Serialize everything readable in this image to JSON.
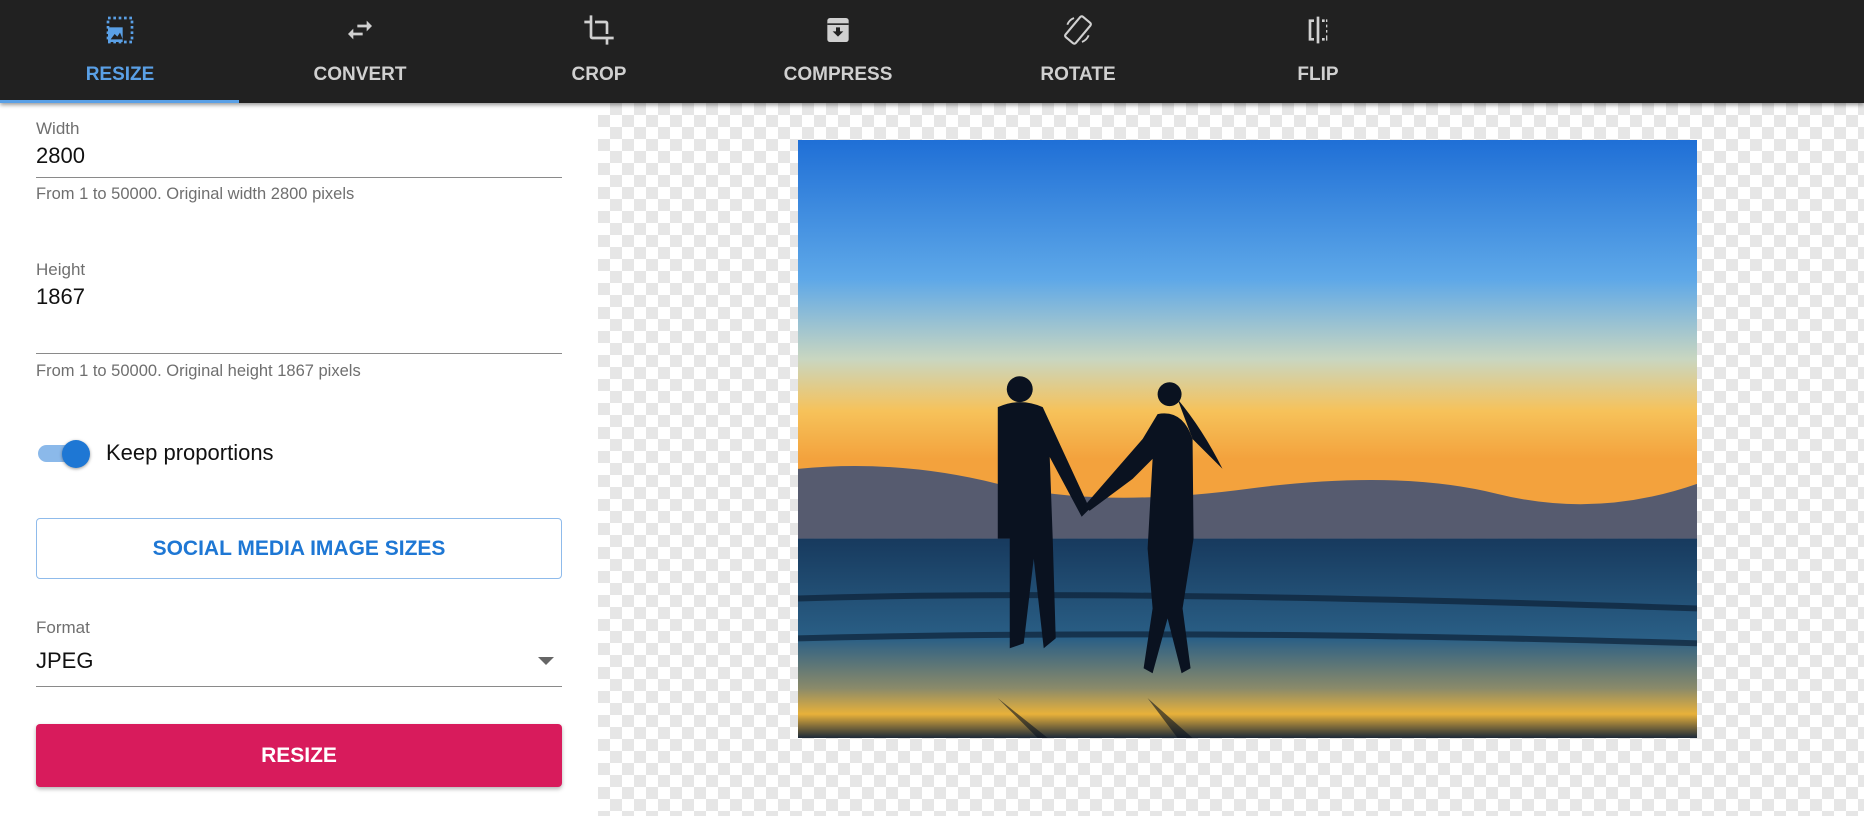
{
  "tabs": [
    {
      "label": "RESIZE",
      "icon": "resize-image-icon",
      "active": true
    },
    {
      "label": "CONVERT",
      "icon": "swap-arrows-icon"
    },
    {
      "label": "CROP",
      "icon": "crop-icon"
    },
    {
      "label": "COMPRESS",
      "icon": "archive-icon"
    },
    {
      "label": "ROTATE",
      "icon": "screen-rotation-icon"
    },
    {
      "label": "FLIP",
      "icon": "flip-icon"
    }
  ],
  "form": {
    "width": {
      "label": "Width",
      "value": "2800",
      "hint": "From 1 to 50000. Original width 2800 pixels"
    },
    "height": {
      "label": "Height",
      "value": "1867",
      "hint": "From 1 to 50000. Original height 1867 pixels"
    },
    "keep_proportions": {
      "label": "Keep proportions",
      "checked": true
    },
    "social_button": "SOCIAL MEDIA IMAGE SIZES",
    "format": {
      "label": "Format",
      "value": "JPEG"
    },
    "submit": "RESIZE"
  },
  "colors": {
    "accent": "#1e77d4",
    "tab_active": "#5aa0e6",
    "primary_button": "#d81b5c",
    "topbar": "#212121"
  }
}
